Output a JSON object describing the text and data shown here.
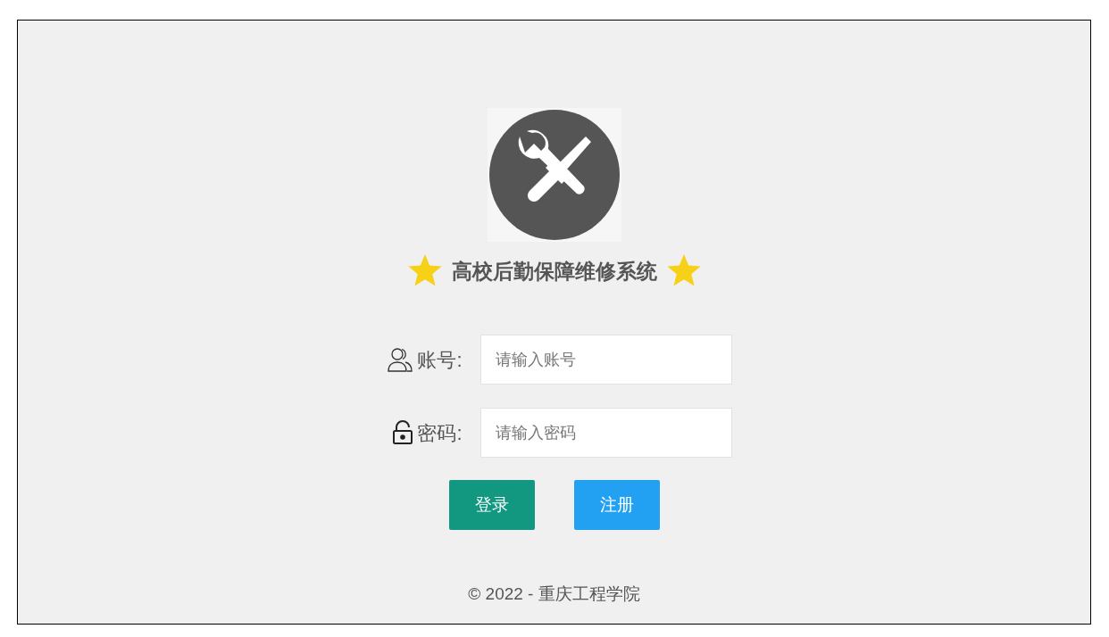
{
  "title": "高校后勤保障维修系统",
  "fields": [
    {
      "kind": "account",
      "label": "账号:",
      "placeholder": "请输入账号"
    },
    {
      "kind": "password",
      "label": "密码:",
      "placeholder": "请输入密码"
    }
  ],
  "buttons": [
    {
      "kind": "login",
      "label": "登录"
    },
    {
      "kind": "register",
      "label": "注册"
    }
  ],
  "footer": "© 2022 - 重庆工程学院"
}
